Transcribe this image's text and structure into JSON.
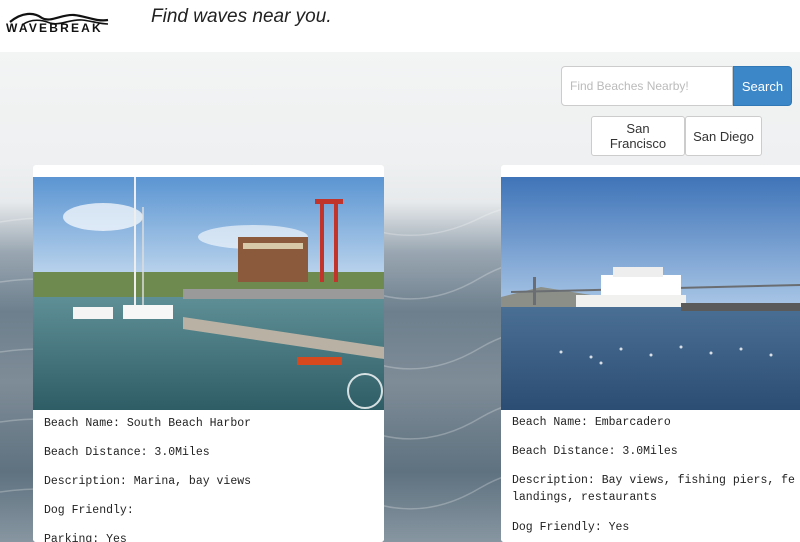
{
  "header": {
    "logo_text": "WAVEBREAK",
    "tagline": "Find waves near you."
  },
  "search": {
    "placeholder": "Find Beaches Nearby!",
    "value": "",
    "button_label": "Search"
  },
  "cities": [
    {
      "label": "San Francisco"
    },
    {
      "label": "San Diego"
    }
  ],
  "beaches": [
    {
      "name_line": "Beach Name: South Beach Harbor",
      "distance_line": "Beach Distance: 3.0Miles",
      "description_line": "Description: Marina, bay views",
      "dog_line": "Dog Friendly:",
      "parking_line": "Parking: Yes"
    },
    {
      "name_line": "Beach Name: Embarcadero",
      "distance_line": "Beach Distance: 3.0Miles",
      "description_line": "Description: Bay views, fishing piers, fe\nlandings, restaurants",
      "dog_line": "Dog Friendly: Yes"
    }
  ],
  "colors": {
    "accent": "#3b87c8",
    "water": "#5f7280"
  }
}
